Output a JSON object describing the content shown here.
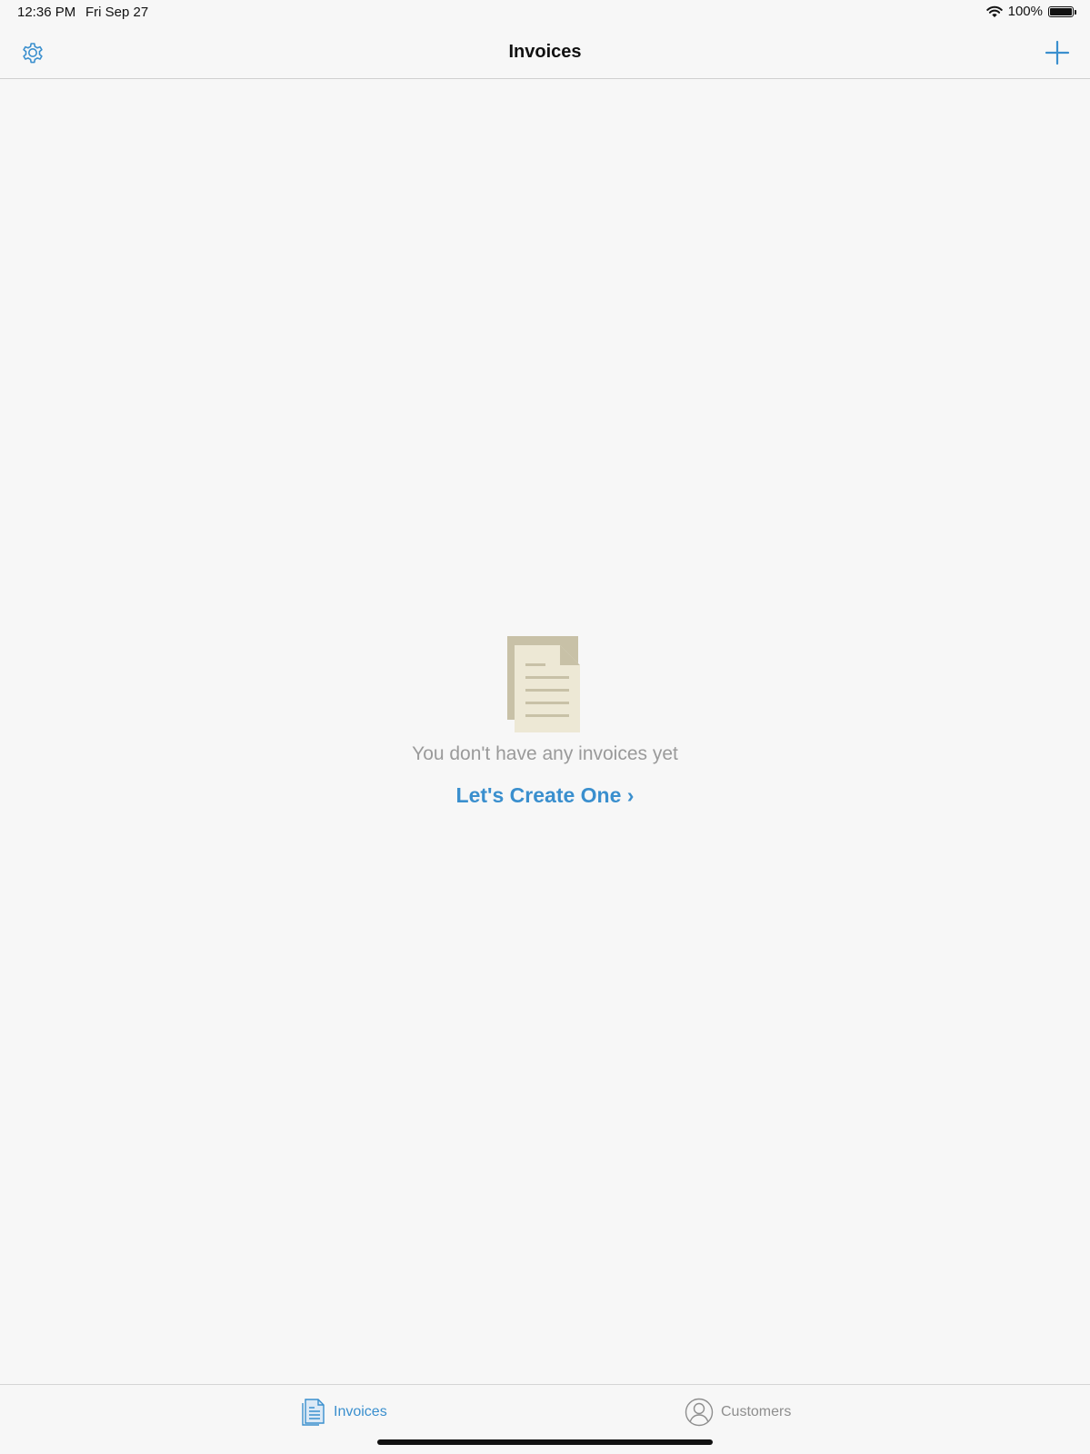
{
  "status_bar": {
    "time": "12:36 PM",
    "date": "Fri Sep 27",
    "battery": "100%",
    "battery_level": 1.0
  },
  "nav": {
    "title": "Invoices",
    "left_icon": "gear-icon",
    "right_icon": "plus-icon"
  },
  "empty_state": {
    "icon": "document-icon",
    "message": "You don't have any invoices yet",
    "cta": "Let's Create One ›"
  },
  "tabs": [
    {
      "label": "Invoices",
      "icon": "invoice-document-icon",
      "selected": true
    },
    {
      "label": "Customers",
      "icon": "person-icon",
      "selected": false
    }
  ],
  "colors": {
    "accent": "#3a8fce",
    "inactive": "#8e8e8e",
    "background": "#f7f7f7",
    "doc_back": "#c8c1a7",
    "doc_front": "#ede8d5",
    "doc_lines": "#c8c1a7"
  }
}
